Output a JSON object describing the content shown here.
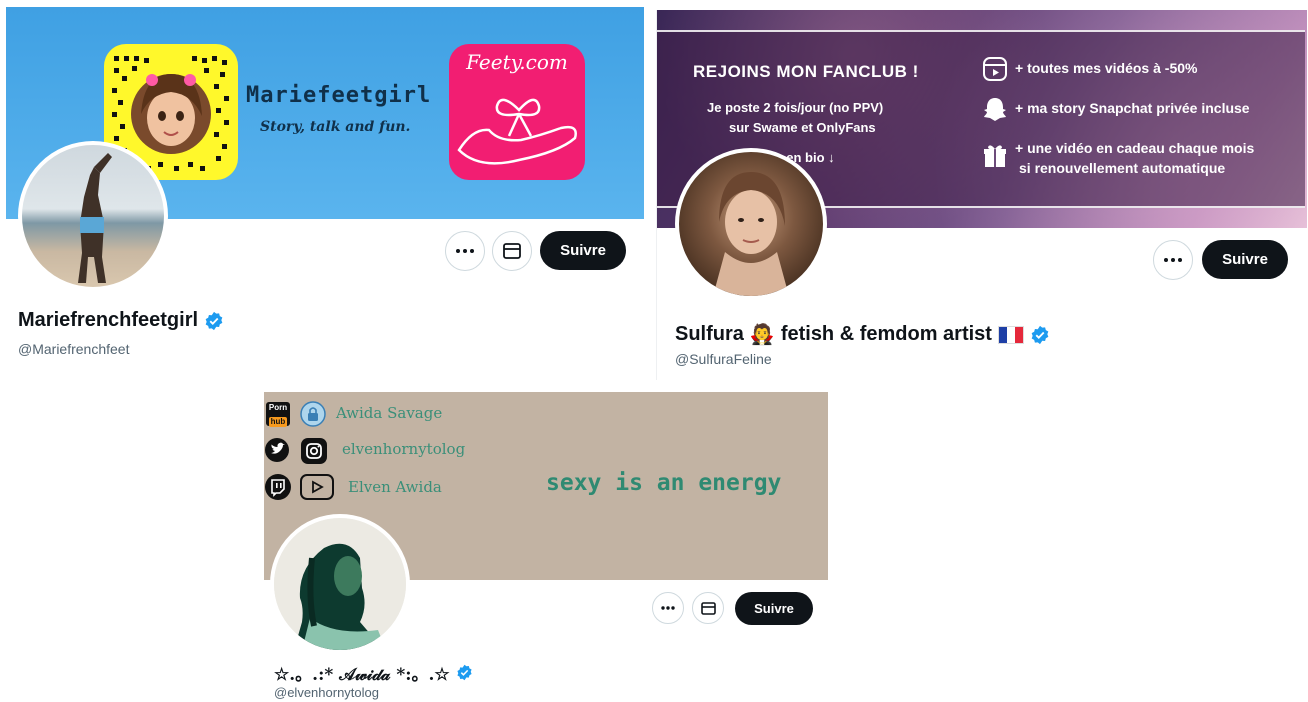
{
  "profile1": {
    "banner": {
      "brand_title": "Mariefeetgirl",
      "tagline": "Story, talk and fun.",
      "feety_label": "Feety.com",
      "bg_color": "#4ea9e6"
    },
    "display_name": "Mariefrenchfeetgirl",
    "handle": "@Mariefrenchfeet",
    "follow_label": "Suivre",
    "more_icon": "more-dots-icon",
    "message_icon": "envelope-icon"
  },
  "profile2": {
    "banner": {
      "headline": "REJOINS MON FANCLUB !",
      "sub_line1": "Je poste 2 fois/jour (no PPV)",
      "sub_line2": "sur Swame et OnlyFans",
      "sub_line3": "liens en bio ↓",
      "bullet1": "+ toutes mes vidéos à -50%",
      "bullet2": "+ ma story Snapchat privée incluse",
      "bullet3_line1": "+ une vidéo en cadeau chaque mois",
      "bullet3_line2": "si renouvellement automatique"
    },
    "display_name_part1": "Sulfura",
    "display_name_emoji": "🧛",
    "display_name_part2": "fetish & femdom artist",
    "handle": "@SulfuraFeline",
    "follow_label": "Suivre"
  },
  "profile3": {
    "banner": {
      "line1": "Awida Savage",
      "line2": "elvenhornytolog",
      "line3": "Elven Awida",
      "slogan": "sexy is an energy",
      "porn_label_top": "Porn",
      "porn_label_bottom": "hub",
      "bg_color": "#c2b3a3",
      "text_color": "#3a8f79"
    },
    "display_name": "☆.。.:* 𝒜𝓌𝒾𝒹𝒶 *:。.☆",
    "handle": "@elvenhornytolog",
    "follow_label": "Suivre"
  },
  "colors": {
    "verified_blue": "#1d9bf0",
    "handle_grey": "#536471",
    "follow_bg": "#0f1419"
  }
}
